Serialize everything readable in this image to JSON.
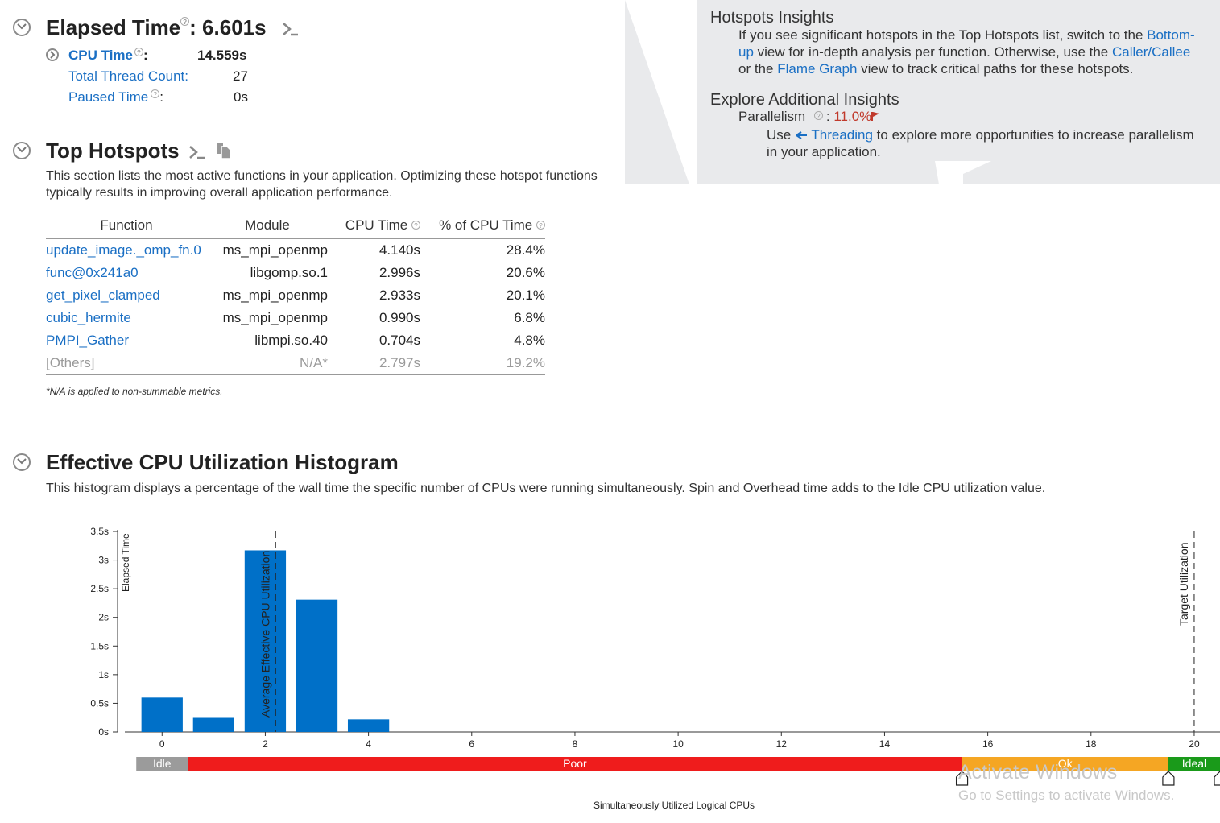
{
  "summary": {
    "elapsed_label": "Elapsed Time",
    "elapsed_value": "6.601s",
    "cpu_time_label": "CPU Time",
    "cpu_time_value": "14.559s",
    "thread_count_label": "Total Thread Count:",
    "thread_count_value": "27",
    "paused_label": "Paused Time",
    "paused_value": "0s"
  },
  "hotspots": {
    "title": "Top Hotspots",
    "description_line1": "This section lists the most active functions in your application. Optimizing these hotspot functions",
    "description_line2": "typically results in improving overall application performance.",
    "columns": [
      "Function",
      "Module",
      "CPU Time",
      "% of CPU Time"
    ],
    "rows": [
      {
        "function": "update_image._omp_fn.0",
        "module": "ms_mpi_openmp",
        "cpu": "4.140s",
        "pct": "28.4%"
      },
      {
        "function": "func@0x241a0",
        "module": "libgomp.so.1",
        "cpu": "2.996s",
        "pct": "20.6%"
      },
      {
        "function": "get_pixel_clamped",
        "module": "ms_mpi_openmp",
        "cpu": "2.933s",
        "pct": "20.1%"
      },
      {
        "function": "cubic_hermite",
        "module": "ms_mpi_openmp",
        "cpu": "0.990s",
        "pct": "6.8%"
      },
      {
        "function": "PMPI_Gather",
        "module": "libmpi.so.40",
        "cpu": "0.704s",
        "pct": "4.8%"
      },
      {
        "function": "[Others]",
        "module": "N/A*",
        "cpu": "2.797s",
        "pct": "19.2%"
      }
    ],
    "footnote": "*N/A is applied to non-summable metrics."
  },
  "insights": {
    "hotspots_title": "Hotspots Insights",
    "hotspots_line1_pre": "If you see significant hotspots in the Top Hotspots list, switch to the ",
    "hotspots_line1_link": "Bottom-",
    "hotspots_line2_link": "up",
    "hotspots_line2_text": " view for in-depth analysis per function. Otherwise, use the ",
    "hotspots_line2_link2": "Caller/Callee",
    "hotspots_line3_pre": "or the ",
    "hotspots_line3_link": "Flame Graph",
    "hotspots_line3_post": " view to track critical paths for these hotspots.",
    "explore_title": "Explore Additional Insights",
    "parallelism_label": "Parallelism",
    "parallelism_value": "11.0%",
    "use_pre": "Use ",
    "threading_link": "Threading",
    "use_post": " to explore more opportunities to increase parallelism",
    "use_line2": "in your application."
  },
  "histogram": {
    "title": "Effective CPU Utilization Histogram",
    "description": "This histogram displays a percentage of the wall time the specific number of CPUs were running simultaneously. Spin and Overhead time adds to the Idle CPU utilization value.",
    "zones": [
      {
        "label": "Idle",
        "color": "#9b9b9b"
      },
      {
        "label": "Poor",
        "color": "#ef1c1c"
      },
      {
        "label": "Ok",
        "color": "#f5a623"
      },
      {
        "label": "Ideal",
        "color": "#1a9a1a"
      }
    ],
    "watermark_line1": "Activate Windows",
    "watermark_line2": "Go to Settings to activate Windows."
  },
  "chart_data": {
    "type": "bar",
    "x": [
      0,
      1,
      2,
      3,
      4
    ],
    "values": [
      0.6,
      0.26,
      3.17,
      2.31,
      0.22
    ],
    "xlabel": "Simultaneously Utilized Logical CPUs",
    "ylabel": "Elapsed Time",
    "xticks": [
      0,
      2,
      4,
      6,
      8,
      10,
      12,
      14,
      16,
      18,
      20
    ],
    "yticks": [
      "0s",
      "0.5s",
      "1s",
      "1.5s",
      "2s",
      "2.5s",
      "3s",
      "3.5s"
    ],
    "ylim": [
      0,
      3.5
    ],
    "xlim": [
      -0.8,
      20.5
    ],
    "bar_color": "#0070c8",
    "average_line": {
      "x": 2.2,
      "label": "Average Effective CPU Utilization"
    },
    "target_line": {
      "x": 20,
      "label": "Target Utilization"
    },
    "zone_bounds": [
      -0.5,
      0.5,
      15.5,
      19.5,
      20.5
    ]
  }
}
